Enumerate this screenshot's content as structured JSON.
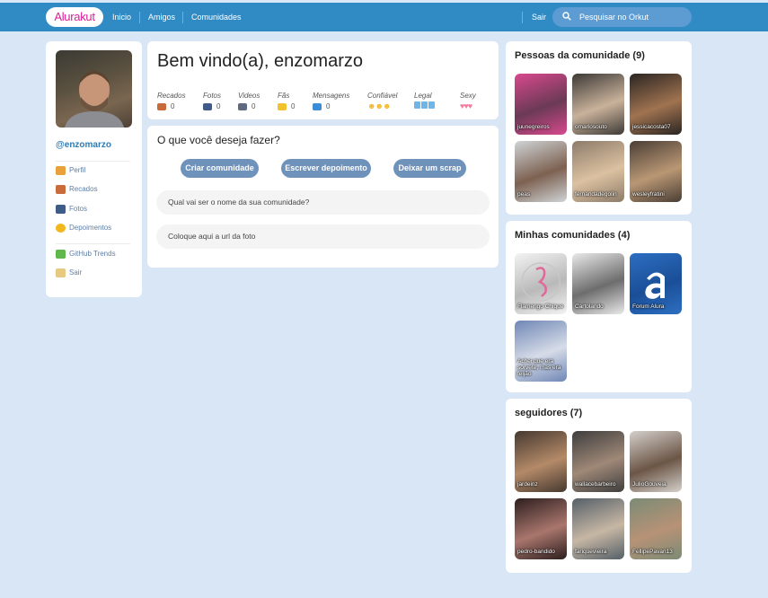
{
  "header": {
    "logo": "Alurakut",
    "nav": [
      "Inicio",
      "Amigos",
      "Comunidades"
    ],
    "logout": "Sair",
    "search_placeholder": "Pesquisar no Orkut"
  },
  "sidebar": {
    "username": "@enzomarzo",
    "menu": [
      {
        "label": "Perfil",
        "icon": "user-icon",
        "color": "#e9a13b"
      },
      {
        "label": "Recados",
        "icon": "book-icon",
        "color": "#c86a3a"
      },
      {
        "label": "Fotos",
        "icon": "camera-icon",
        "color": "#3f5b88"
      },
      {
        "label": "Depoimentos",
        "icon": "sun-icon",
        "color": "#f2b71d"
      }
    ],
    "menu2": [
      {
        "label": "GitHub Trends",
        "icon": "plus-icon",
        "color": "#5fb64b"
      },
      {
        "label": "Sair",
        "icon": "logout-icon",
        "color": "#e7c982"
      }
    ]
  },
  "welcome": {
    "title": "Bem vindo(a), enzomarzo",
    "stats": [
      {
        "label": "Recados",
        "value": "0",
        "icon": "book-icon"
      },
      {
        "label": "Fotos",
        "value": "0",
        "icon": "camera-icon"
      },
      {
        "label": "Videos",
        "value": "0",
        "icon": "video-icon"
      },
      {
        "label": "Fãs",
        "value": "0",
        "icon": "star-icon"
      },
      {
        "label": "Mensagens",
        "value": "0",
        "icon": "mail-icon"
      },
      {
        "label": "Confiável",
        "icon": "smiley-icon"
      },
      {
        "label": "Legal",
        "icon": "cube-icon"
      },
      {
        "label": "Sexy",
        "icon": "heart-icon"
      }
    ],
    "smileys": "☻☻☻",
    "hearts": "♥♥♥"
  },
  "actions": {
    "title": "O que você deseja fazer?",
    "buttons": [
      "Criar comunidade",
      "Escrever depoimento",
      "Deixar um scrap"
    ],
    "name_placeholder": "Qual vai ser o nome da sua comunidade?",
    "url_placeholder": "Coloque aqui a url da foto"
  },
  "people": {
    "title": "Pessoas da comunidade (9)",
    "items": [
      {
        "name": "juunegreiros",
        "color1": "#d8498e",
        "color2": "#6b3a55"
      },
      {
        "name": "omariosouto",
        "color1": "#3d3a36",
        "color2": "#c9b29b"
      },
      {
        "name": "jessicacosta07",
        "color1": "#2b2522",
        "color2": "#a07350"
      },
      {
        "name": "peas",
        "color1": "#cfd4d6",
        "color2": "#7d6151"
      },
      {
        "name": "fernandadegolin",
        "color1": "#8c7b69",
        "color2": "#dcc1a1"
      },
      {
        "name": "wesleyfratini",
        "color1": "#4a3e35",
        "color2": "#b99774"
      }
    ]
  },
  "communities": {
    "title": "Minhas comunidades (4)",
    "items": [
      {
        "name": "Flamengo Chique",
        "color1": "#f3f3f3",
        "color2": "#b9b9b9"
      },
      {
        "name": "Cartolando",
        "color1": "#e9e9e9",
        "color2": "#6d6d6d"
      },
      {
        "name": "Forum Alura",
        "color1": "#2d6ec2",
        "color2": "#1a4f97"
      },
      {
        "name": "Achei que era sorvete, mas era feijão",
        "color1": "#6f86b5",
        "color2": "#d6dce8"
      }
    ]
  },
  "followers": {
    "title": "seguidores (7)",
    "items": [
      {
        "name": "jardeinz",
        "color1": "#463930",
        "color2": "#b48a68"
      },
      {
        "name": "wallacebarbeiro",
        "color1": "#3e3e3e",
        "color2": "#9f8877"
      },
      {
        "name": "JulioGouveia",
        "color1": "#d4d0cc",
        "color2": "#6c5646"
      },
      {
        "name": "pedro-bandido",
        "color1": "#2d1e1e",
        "color2": "#a9766d"
      },
      {
        "name": "fariquevieira",
        "color1": "#556068",
        "color2": "#c7b7a4"
      },
      {
        "name": "FellipePavan13",
        "color1": "#7b8b75",
        "color2": "#b79276"
      }
    ]
  }
}
